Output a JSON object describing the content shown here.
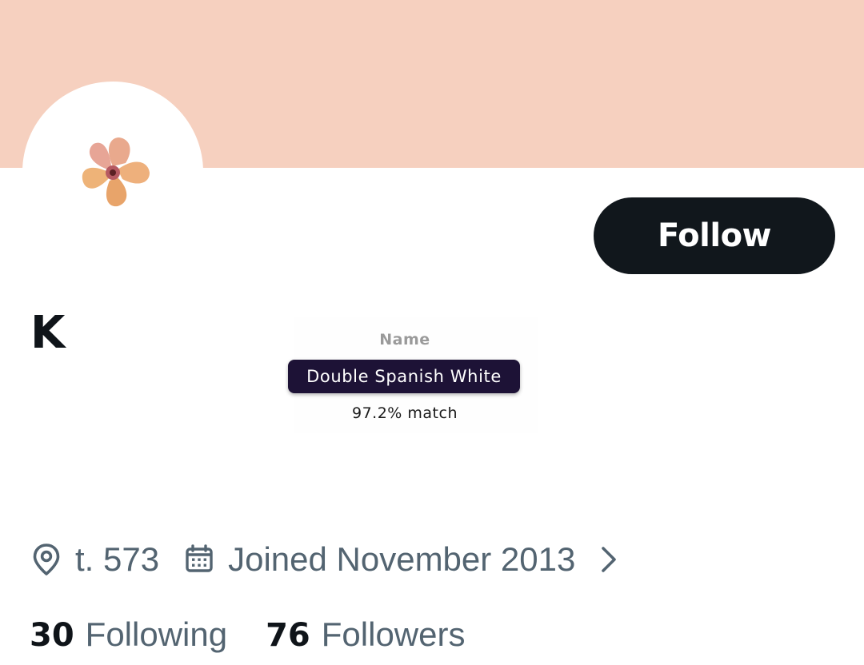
{
  "colors": {
    "banner": "#f6d0bf",
    "follow_button_bg": "#11171c",
    "tag_bg": "#1d1236",
    "secondary_text": "#536471"
  },
  "header": {
    "avatar_icon": "hibiscus-flower"
  },
  "actions": {
    "follow_label": "Follow"
  },
  "profile": {
    "display_name": "K",
    "location": "t. 573",
    "joined": "Joined November 2013",
    "location_icon": "map-pin-icon",
    "joined_icon": "calendar-icon",
    "more_icon": "chevron-right-icon"
  },
  "color_overlay": {
    "label": "Name",
    "color_name": "Double Spanish White",
    "match": "97.2% match"
  },
  "stats": {
    "following_count": "30",
    "following_label": "Following",
    "followers_count": "76",
    "followers_label": "Followers"
  }
}
